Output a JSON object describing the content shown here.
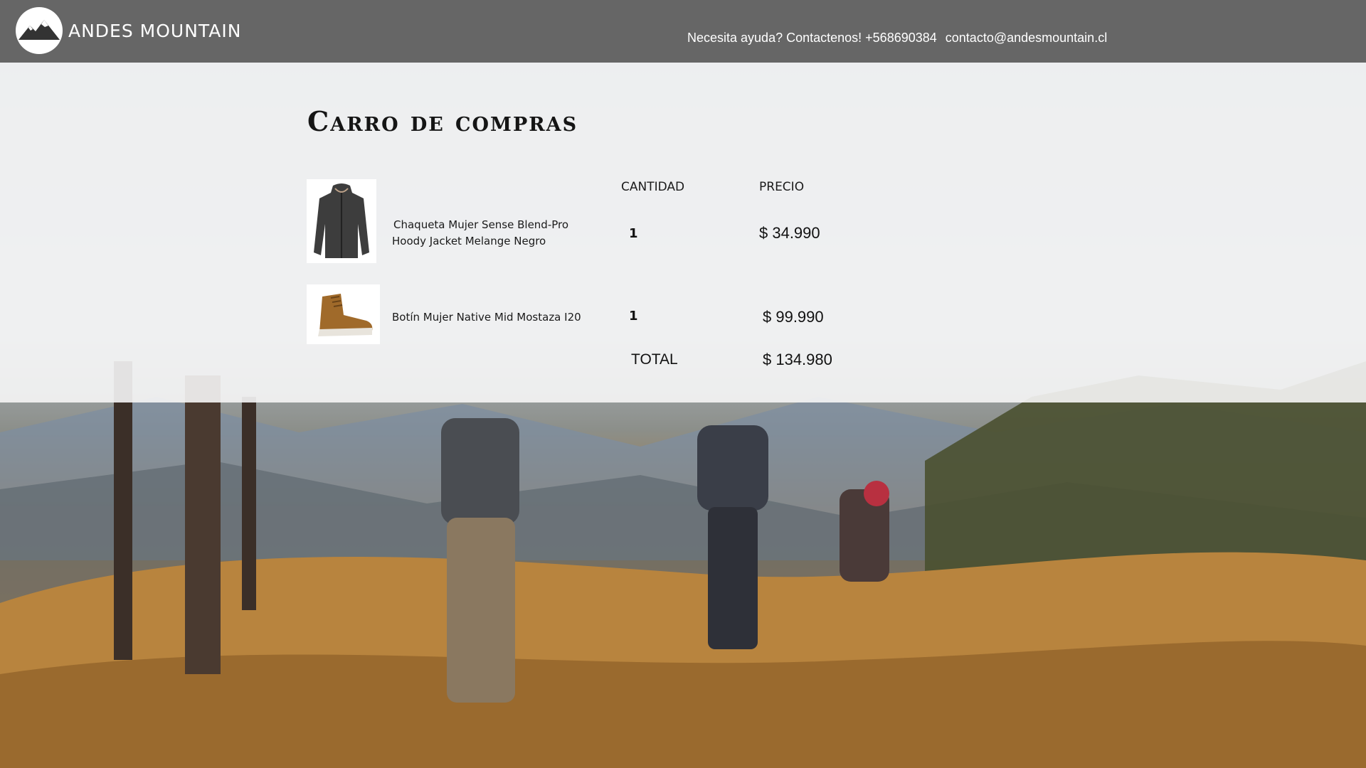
{
  "header": {
    "brand": "ANDES MOUNTAIN",
    "help_text": "Necesita ayuda? Contactenos! +568690384",
    "email": "contacto@andesmountain.cl"
  },
  "cart": {
    "title": "Carro de compras",
    "col_quantity": "CANTIDAD",
    "col_price": "PRECIO",
    "items": [
      {
        "name_line1": "Chaqueta Mujer Sense Blend-Pro",
        "name_line2": "Hoody Jacket Melange Negro",
        "quantity": "1",
        "price": "$ 34.990",
        "image": "jacket-image"
      },
      {
        "name_line1": "Botín Mujer Native Mid Mostaza I20",
        "quantity": "1",
        "price": "$ 99.990",
        "image": "boot-image"
      }
    ],
    "total_label": "TOTAL",
    "total_value": "$ 134.980"
  },
  "colors": {
    "topbar": "#666666",
    "overlay": "#f6f6f6",
    "text": "#111111"
  }
}
